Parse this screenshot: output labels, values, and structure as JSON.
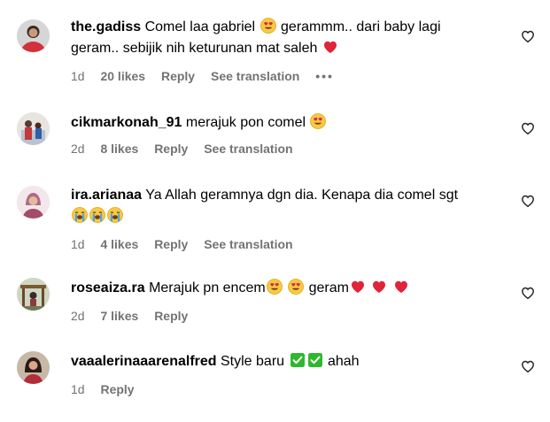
{
  "comments": [
    {
      "username": "the.gadiss",
      "text_parts": [
        "Comel laa gabriel",
        "gerammm.. dari baby lagi",
        "geram.. sebijik nih keturunan mat saleh"
      ],
      "time": "1d",
      "likes": "20 likes",
      "reply": "Reply",
      "translation": "See translation",
      "more": "•••"
    },
    {
      "username": "cikmarkonah_91",
      "text": "merajuk pon comel",
      "time": "2d",
      "likes": "8 likes",
      "reply": "Reply",
      "translation": "See translation"
    },
    {
      "username": "ira.arianaa",
      "text": "Ya Allah geramnya dgn dia. Kenapa dia comel sgt",
      "time": "1d",
      "likes": "4 likes",
      "reply": "Reply",
      "translation": "See translation"
    },
    {
      "username": "roseaiza.ra",
      "text_parts": [
        "Merajuk pn encem",
        "geram"
      ],
      "time": "2d",
      "likes": "7 likes",
      "reply": "Reply"
    },
    {
      "username": "vaaalerinaaarenalfred",
      "text_parts": [
        "Style baru",
        "ahah"
      ],
      "time": "1d",
      "reply": "Reply"
    }
  ],
  "icons": {
    "like": "heart-outline-icon",
    "emoji_heart_eyes": "heart-eyes-emoji",
    "emoji_red_heart": "red-heart-emoji",
    "emoji_crying": "loudly-crying-emoji",
    "emoji_check": "check-mark-button-emoji"
  },
  "colors": {
    "meta": "#737373",
    "text": "#000000",
    "heart_red": "#e0243a",
    "check_green": "#2eb82e"
  }
}
